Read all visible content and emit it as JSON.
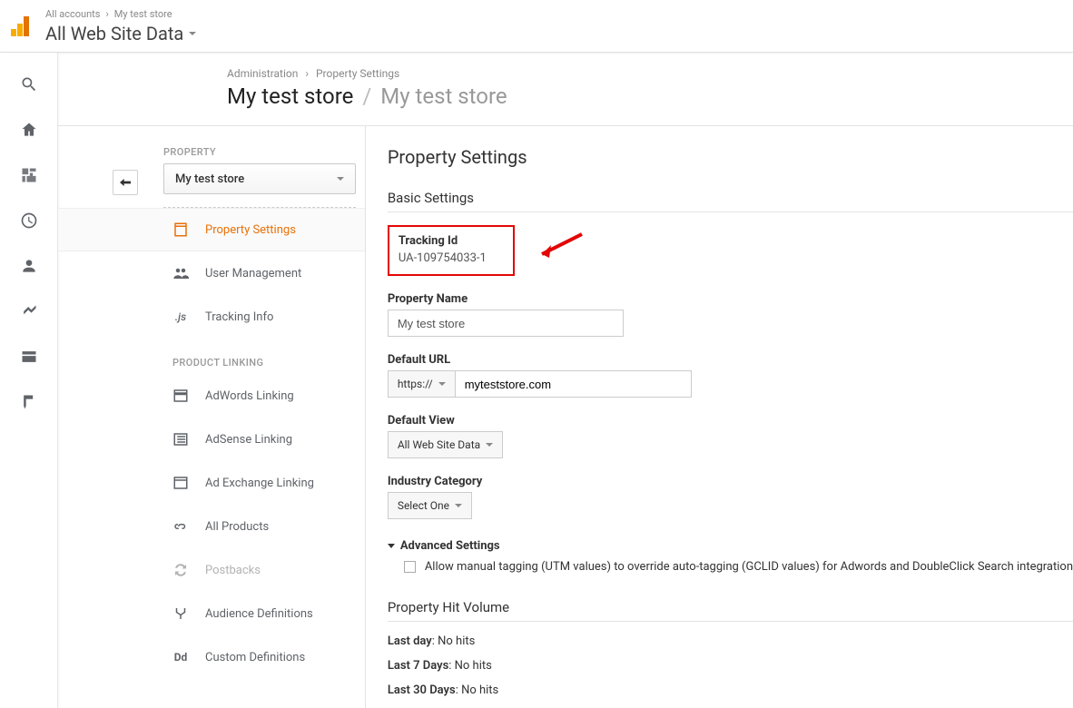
{
  "top": {
    "breadcrumb": [
      "All accounts",
      "My test store"
    ],
    "selector_label": "All Web Site Data"
  },
  "page": {
    "crumb": [
      "Administration",
      "Property Settings"
    ],
    "title": "My test store",
    "subtitle": "My test store"
  },
  "propertyNav": {
    "header": "PROPERTY",
    "selected": "My test store",
    "items": [
      {
        "key": "property-settings",
        "label": "Property Settings",
        "active": true
      },
      {
        "key": "user-management",
        "label": "User Management"
      },
      {
        "key": "tracking-info",
        "label": "Tracking Info"
      }
    ],
    "linkingHeader": "PRODUCT LINKING",
    "linking": [
      {
        "key": "adwords-linking",
        "label": "AdWords Linking"
      },
      {
        "key": "adsense-linking",
        "label": "AdSense Linking"
      },
      {
        "key": "adexchange-linking",
        "label": "Ad Exchange Linking"
      },
      {
        "key": "all-products",
        "label": "All Products"
      },
      {
        "key": "postbacks",
        "label": "Postbacks",
        "disabled": true
      },
      {
        "key": "audience-definitions",
        "label": "Audience Definitions"
      },
      {
        "key": "custom-definitions",
        "label": "Custom Definitions"
      }
    ]
  },
  "settings": {
    "title": "Property Settings",
    "basic_header": "Basic Settings",
    "tracking_label": "Tracking Id",
    "tracking_value": "UA-109754033-1",
    "property_name_label": "Property Name",
    "property_name_value": "My test store",
    "default_url_label": "Default URL",
    "protocol": "https://",
    "default_url_value": "myteststore.com",
    "default_view_label": "Default View",
    "default_view_value": "All Web Site Data",
    "industry_label": "Industry Category",
    "industry_value": "Select One",
    "advanced_label": "Advanced Settings",
    "advanced_checkbox": "Allow manual tagging (UTM values) to override auto-tagging (GCLID values) for Adwords and DoubleClick Search integration",
    "hit_header": "Property Hit Volume",
    "hits": [
      {
        "label": "Last day",
        "value": "No hits"
      },
      {
        "label": "Last 7 Days",
        "value": "No hits"
      },
      {
        "label": "Last 30 Days",
        "value": "No hits"
      }
    ]
  }
}
